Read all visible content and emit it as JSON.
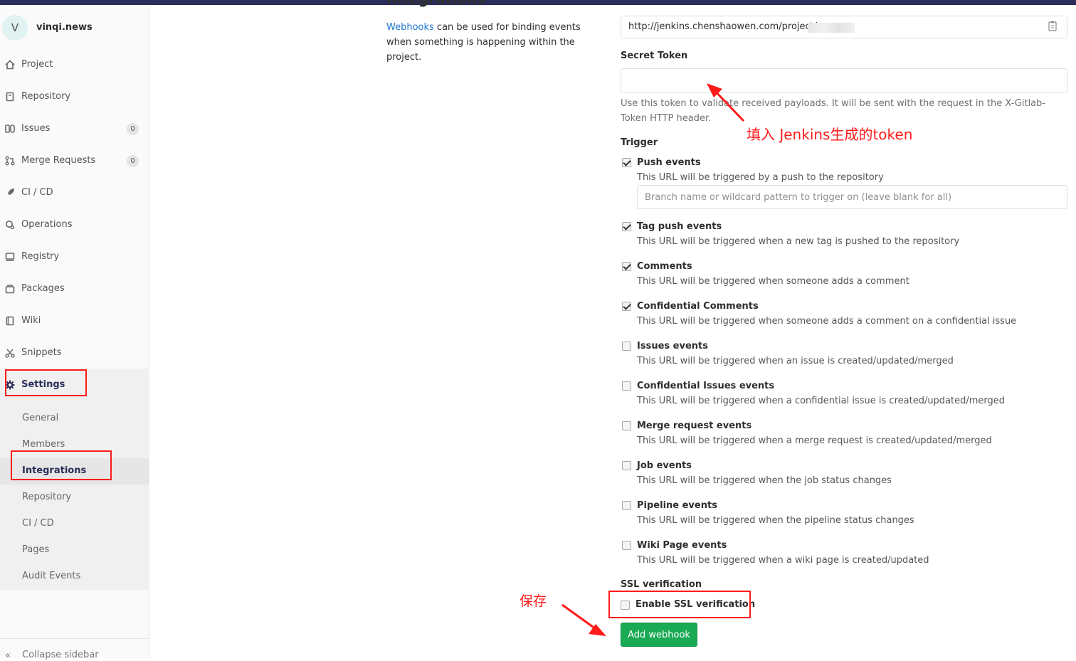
{
  "project": {
    "initial": "V",
    "name": "vinqi.news"
  },
  "sidebar": {
    "items": [
      {
        "label": "Project"
      },
      {
        "label": "Repository"
      },
      {
        "label": "Issues",
        "count": "0"
      },
      {
        "label": "Merge Requests",
        "count": "0"
      },
      {
        "label": "CI / CD"
      },
      {
        "label": "Operations"
      },
      {
        "label": "Registry"
      },
      {
        "label": "Packages"
      },
      {
        "label": "Wiki"
      },
      {
        "label": "Snippets"
      },
      {
        "label": "Settings"
      }
    ],
    "settings_sub": [
      {
        "label": "General"
      },
      {
        "label": "Members"
      },
      {
        "label": "Integrations"
      },
      {
        "label": "Repository"
      },
      {
        "label": "CI / CD"
      },
      {
        "label": "Pages"
      },
      {
        "label": "Audit Events"
      }
    ],
    "collapse_label": "Collapse sidebar"
  },
  "page": {
    "heading": "Integrations",
    "desc_link": "Webhooks",
    "desc_rest": " can be used for binding events when something is happening within the project."
  },
  "form": {
    "url_value": "http://jenkins.chenshaowen.com/project/",
    "secret_label": "Secret Token",
    "secret_help": "Use this token to validate received payloads. It will be sent with the request in the X-Gitlab-Token HTTP header.",
    "trigger_label": "Trigger",
    "branch_placeholder": "Branch name or wildcard pattern to trigger on (leave blank for all)",
    "triggers": [
      {
        "title": "Push events",
        "desc": "This URL will be triggered by a push to the repository",
        "checked": true
      },
      {
        "title": "Tag push events",
        "desc": "This URL will be triggered when a new tag is pushed to the repository",
        "checked": true
      },
      {
        "title": "Comments",
        "desc": "This URL will be triggered when someone adds a comment",
        "checked": true
      },
      {
        "title": "Confidential Comments",
        "desc": "This URL will be triggered when someone adds a comment on a confidential issue",
        "checked": true
      },
      {
        "title": "Issues events",
        "desc": "This URL will be triggered when an issue is created/updated/merged",
        "checked": false
      },
      {
        "title": "Confidential Issues events",
        "desc": "This URL will be triggered when a confidential issue is created/updated/merged",
        "checked": false
      },
      {
        "title": "Merge request events",
        "desc": "This URL will be triggered when a merge request is created/updated/merged",
        "checked": false
      },
      {
        "title": "Job events",
        "desc": "This URL will be triggered when the job status changes",
        "checked": false
      },
      {
        "title": "Pipeline events",
        "desc": "This URL will be triggered when the pipeline status changes",
        "checked": false
      },
      {
        "title": "Wiki Page events",
        "desc": "This URL will be triggered when a wiki page is created/updated",
        "checked": false
      }
    ],
    "ssl_label": "SSL verification",
    "ssl_checkbox_label": "Enable SSL verification",
    "ssl_checked": false,
    "submit_label": "Add webhook"
  },
  "annotations": {
    "token_note": "填入 Jenkins生成的token",
    "save_note": "保存"
  },
  "colors": {
    "accent": "#2b2d5a",
    "link": "#1f78d1",
    "success": "#1aaa55",
    "annotation": "#ff1a1a"
  }
}
